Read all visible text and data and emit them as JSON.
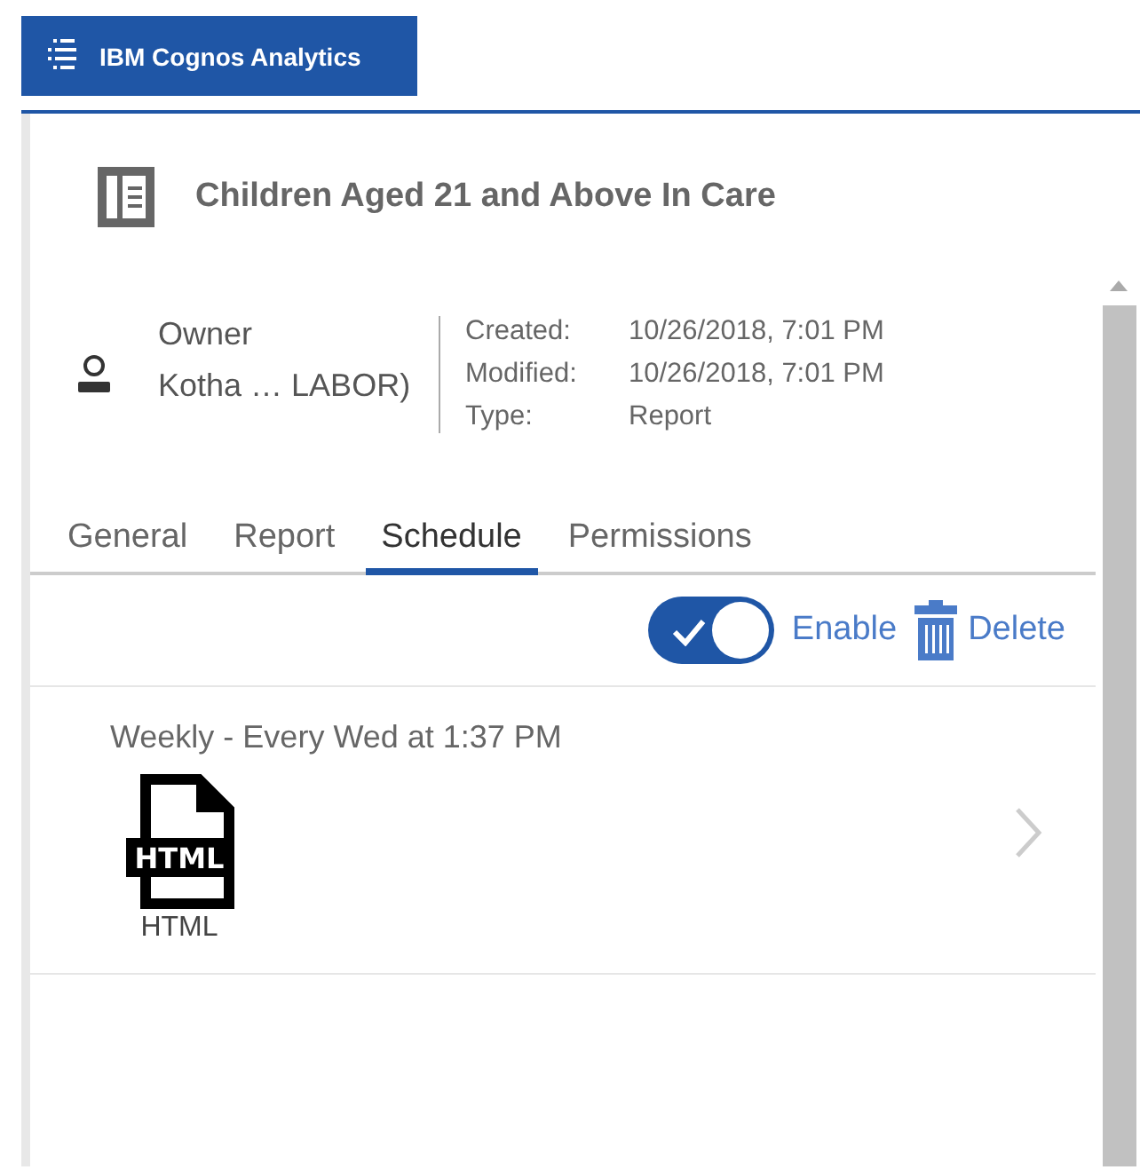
{
  "app_button": {
    "label": "IBM Cognos Analytics"
  },
  "report": {
    "title": "Children Aged 21 and Above In Care"
  },
  "owner": {
    "label": "Owner",
    "name": "Kotha … LABOR)"
  },
  "properties": [
    {
      "label": "Created:",
      "value": "10/26/2018, 7:01 PM"
    },
    {
      "label": "Modified:",
      "value": "10/26/2018, 7:01 PM"
    },
    {
      "label": "Type:",
      "value": "Report"
    }
  ],
  "tabs": [
    {
      "label": "General",
      "selected": false
    },
    {
      "label": "Report",
      "selected": false
    },
    {
      "label": "Schedule",
      "selected": true
    },
    {
      "label": "Permissions",
      "selected": false
    }
  ],
  "toolbar": {
    "enable": {
      "label": "Enable",
      "on": true
    },
    "delete": {
      "label": "Delete"
    }
  },
  "schedules": [
    {
      "description": "Weekly - Every Wed at 1:37 PM",
      "format_badge": "HTML",
      "format": "HTML"
    }
  ]
}
